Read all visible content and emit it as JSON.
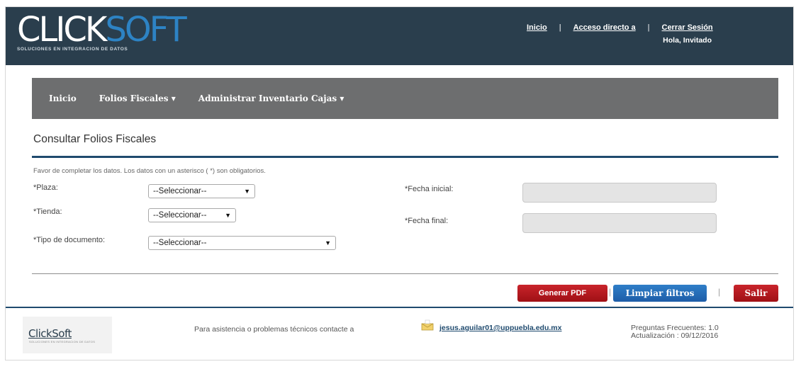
{
  "header": {
    "logo_click": "CLICK",
    "logo_soft": "SOFT",
    "logo_tagline": "SOLUCIONES EN INTEGRACION DE DATOS",
    "links": {
      "home": "Inicio",
      "shortcut": "Acceso directo a",
      "logout": "Cerrar Sesión"
    },
    "separator": "|",
    "greeting": "Hola, Invitado"
  },
  "nav": {
    "items": [
      "Inicio",
      "Folios Fiscales ▾",
      "Administrar Inventario Cajas ▾"
    ]
  },
  "page": {
    "title": "Consultar Folios Fiscales",
    "instructions": "Favor de completar los datos. Los datos con un asterisco ( *) son obligatorios."
  },
  "form": {
    "plaza": {
      "label": "*Plaza:",
      "value": "--Seleccionar--"
    },
    "tienda": {
      "label": "*Tienda:",
      "value": "--Seleccionar--"
    },
    "tipo_documento": {
      "label": "*Tipo de documento:",
      "value": "--Seleccionar--"
    },
    "fecha_inicial": {
      "label": "*Fecha inicial:",
      "value": ""
    },
    "fecha_final": {
      "label": "*Fecha final:",
      "value": ""
    },
    "caret": "▼"
  },
  "buttons": {
    "pdf": "Generar PDF",
    "clear": "Limpiar filtros",
    "exit": "Salir",
    "separator": "|"
  },
  "footer": {
    "logo": "ClickSoft",
    "logo_sub": "SOLUCIONES EN INTEGRACION DE DATOS",
    "assist": "Para asistencia o problemas técnicos contacte a",
    "email": "jesus.aguilar01@uppuebla.edu.mx",
    "faq": "Preguntas Frecuentes: 1.0",
    "version": "Actualización : 09/12/2016"
  },
  "colors": {
    "header_bg": "#2a3e4d",
    "nav_bg": "#6d6e6f",
    "accent_blue": "#1f4a6e",
    "btn_red": "#b31b21",
    "btn_blue": "#2a6fb8",
    "logo_soft": "#2d83c4"
  },
  "icons": {
    "mail": "mail-icon"
  }
}
